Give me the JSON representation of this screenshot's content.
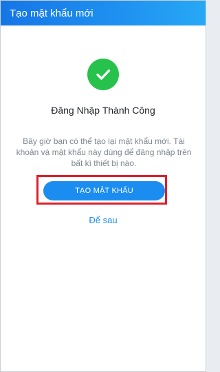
{
  "header": {
    "title": "Tạo mật khẩu mới"
  },
  "main": {
    "success_icon": "check-circle-icon",
    "title": "Đăng Nhập Thành Công",
    "description": "Bây giờ bạn có thể tạo lại mật khẩu mới. Tài khoản và mật khẩu này dùng để đăng nhập trên bất kì thiết bị nào.",
    "create_password_label": "TẠO MẬT KHẨU",
    "later_label": "Để sau"
  },
  "colors": {
    "header_gradient": [
      "#1576e6",
      "#27a8f5"
    ],
    "success": "#27c24c",
    "accent": "#1b8df0",
    "highlight": "#e01e2b"
  }
}
